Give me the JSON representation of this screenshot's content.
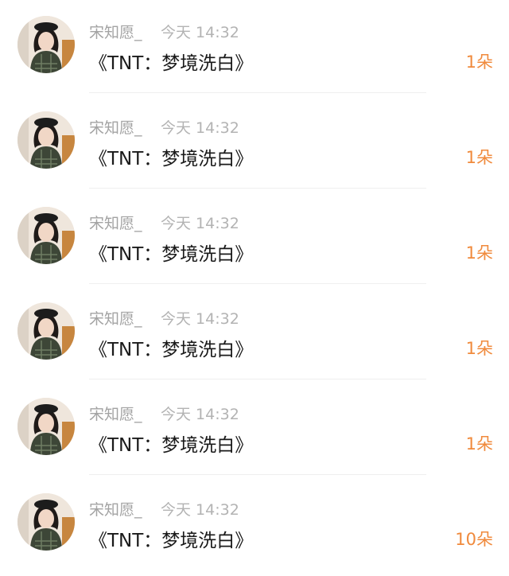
{
  "items": [
    {
      "username": "宋知愿_",
      "time": "今天 14:32",
      "message": "《TNT：梦境洗白》",
      "count": "1朵",
      "avatar_icon": "user-avatar-icon"
    },
    {
      "username": "宋知愿_",
      "time": "今天 14:32",
      "message": "《TNT：梦境洗白》",
      "count": "1朵",
      "avatar_icon": "user-avatar-icon"
    },
    {
      "username": "宋知愿_",
      "time": "今天 14:32",
      "message": "《TNT：梦境洗白》",
      "count": "1朵",
      "avatar_icon": "user-avatar-icon"
    },
    {
      "username": "宋知愿_",
      "time": "今天 14:32",
      "message": "《TNT：梦境洗白》",
      "count": "1朵",
      "avatar_icon": "user-avatar-icon"
    },
    {
      "username": "宋知愿_",
      "time": "今天 14:32",
      "message": "《TNT：梦境洗白》",
      "count": "1朵",
      "avatar_icon": "user-avatar-icon"
    },
    {
      "username": "宋知愿_",
      "time": "今天 14:32",
      "message": "《TNT：梦境洗白》",
      "count": "10朵",
      "avatar_icon": "user-avatar-icon"
    }
  ],
  "colors": {
    "username": "#a3a3a3",
    "time": "#b3b3b3",
    "message": "#1a1a1a",
    "count_accent": "#f08a3c",
    "divider": "#efefef"
  }
}
